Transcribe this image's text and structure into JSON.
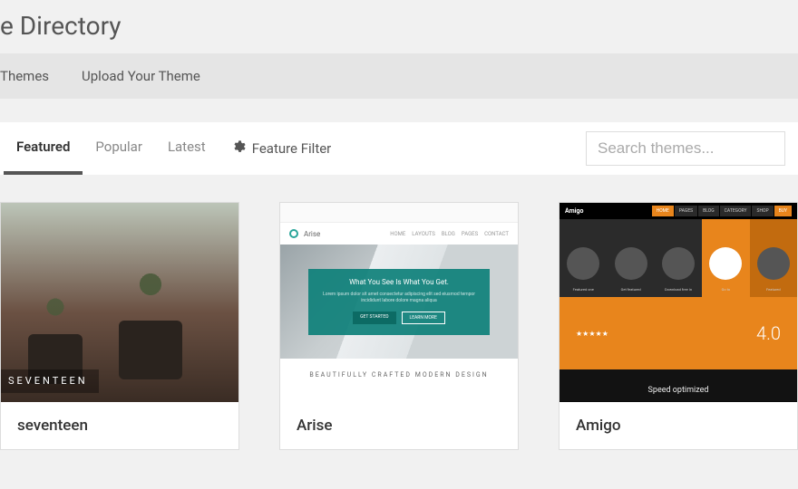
{
  "header": {
    "title": "e Directory"
  },
  "toolbar": {
    "themes_link": "Themes",
    "upload_link": "Upload Your Theme"
  },
  "filter": {
    "tabs": [
      {
        "label": "Featured",
        "active": true
      },
      {
        "label": "Popular",
        "active": false
      },
      {
        "label": "Latest",
        "active": false
      }
    ],
    "feature_filter_label": "Feature Filter"
  },
  "search": {
    "placeholder": "Search themes..."
  },
  "themes": [
    {
      "name": "seventeen",
      "badge_line1": "SEVENTEEN",
      "badge_line2": ""
    },
    {
      "name": "Arise",
      "preview": {
        "brand": "Arise",
        "nav": [
          "HOME",
          "LAYOUTS",
          "BLOG",
          "PAGES",
          "CONTACT"
        ],
        "hero_heading": "What You See Is What You Get.",
        "hero_text": "Lorem ipsum dolor sit amet consectetur adipiscing elit sed eiusmod tempor incididunt labore dolore magna aliqua",
        "btn_primary": "GET STARTED",
        "btn_secondary": "LEARN MORE",
        "caption": "BEAUTIFULLY CRAFTED MODERN DESIGN"
      }
    },
    {
      "name": "Amigo",
      "preview": {
        "brand": "Amigo",
        "nav": [
          "HOME",
          "PAGES",
          "BLOG",
          "CATEGORY",
          "SHOP",
          "BUY"
        ],
        "cells": [
          "Featured one",
          "Get featured",
          "Download free in",
          "Go to",
          "Featured"
        ],
        "stars": "★★★★★",
        "version": "4.0",
        "footer_heading": "Speed optimized"
      }
    }
  ]
}
